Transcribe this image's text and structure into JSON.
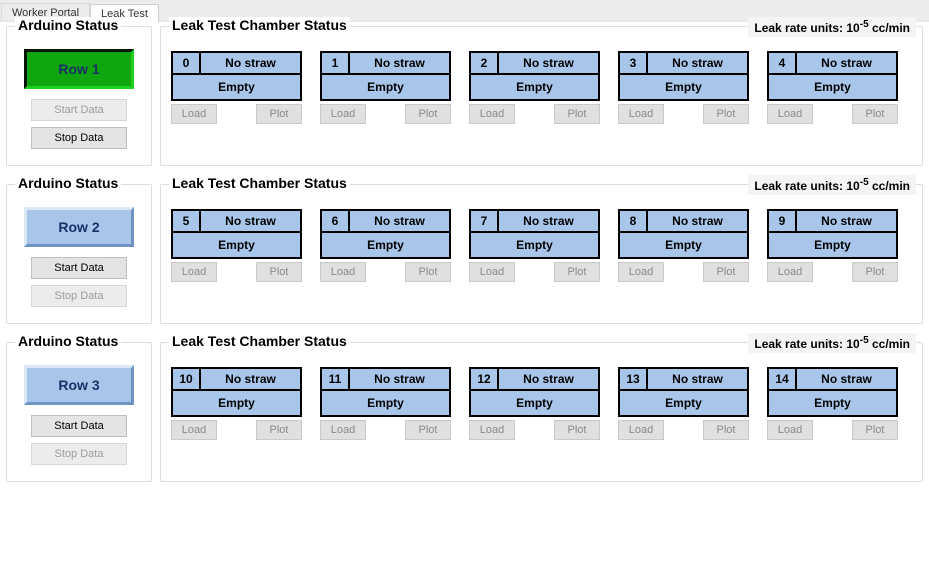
{
  "tabs": [
    {
      "label": "Worker Portal",
      "active": false
    },
    {
      "label": "Leak Test",
      "active": true
    }
  ],
  "arduino_title": "Arduino Status",
  "chamber_title": "Leak Test Chamber Status",
  "unit_label_prefix": "Leak rate units: 10",
  "unit_label_exp": "-5",
  "unit_label_suffix": " cc/min",
  "start_label": "Start Data",
  "stop_label": "Stop Data",
  "load_label": "Load",
  "plot_label": "Plot",
  "rows": [
    {
      "row_label": "Row 1",
      "active": true,
      "start_enabled": false,
      "stop_enabled": true,
      "chambers": [
        {
          "id": "0",
          "straw": "No straw",
          "status": "Empty"
        },
        {
          "id": "1",
          "straw": "No straw",
          "status": "Empty"
        },
        {
          "id": "2",
          "straw": "No straw",
          "status": "Empty"
        },
        {
          "id": "3",
          "straw": "No straw",
          "status": "Empty"
        },
        {
          "id": "4",
          "straw": "No straw",
          "status": "Empty"
        }
      ]
    },
    {
      "row_label": "Row 2",
      "active": false,
      "start_enabled": true,
      "stop_enabled": false,
      "chambers": [
        {
          "id": "5",
          "straw": "No straw",
          "status": "Empty"
        },
        {
          "id": "6",
          "straw": "No straw",
          "status": "Empty"
        },
        {
          "id": "7",
          "straw": "No straw",
          "status": "Empty"
        },
        {
          "id": "8",
          "straw": "No straw",
          "status": "Empty"
        },
        {
          "id": "9",
          "straw": "No straw",
          "status": "Empty"
        }
      ]
    },
    {
      "row_label": "Row 3",
      "active": false,
      "start_enabled": true,
      "stop_enabled": false,
      "chambers": [
        {
          "id": "10",
          "straw": "No straw",
          "status": "Empty"
        },
        {
          "id": "11",
          "straw": "No straw",
          "status": "Empty"
        },
        {
          "id": "12",
          "straw": "No straw",
          "status": "Empty"
        },
        {
          "id": "13",
          "straw": "No straw",
          "status": "Empty"
        },
        {
          "id": "14",
          "straw": "No straw",
          "status": "Empty"
        }
      ]
    }
  ]
}
